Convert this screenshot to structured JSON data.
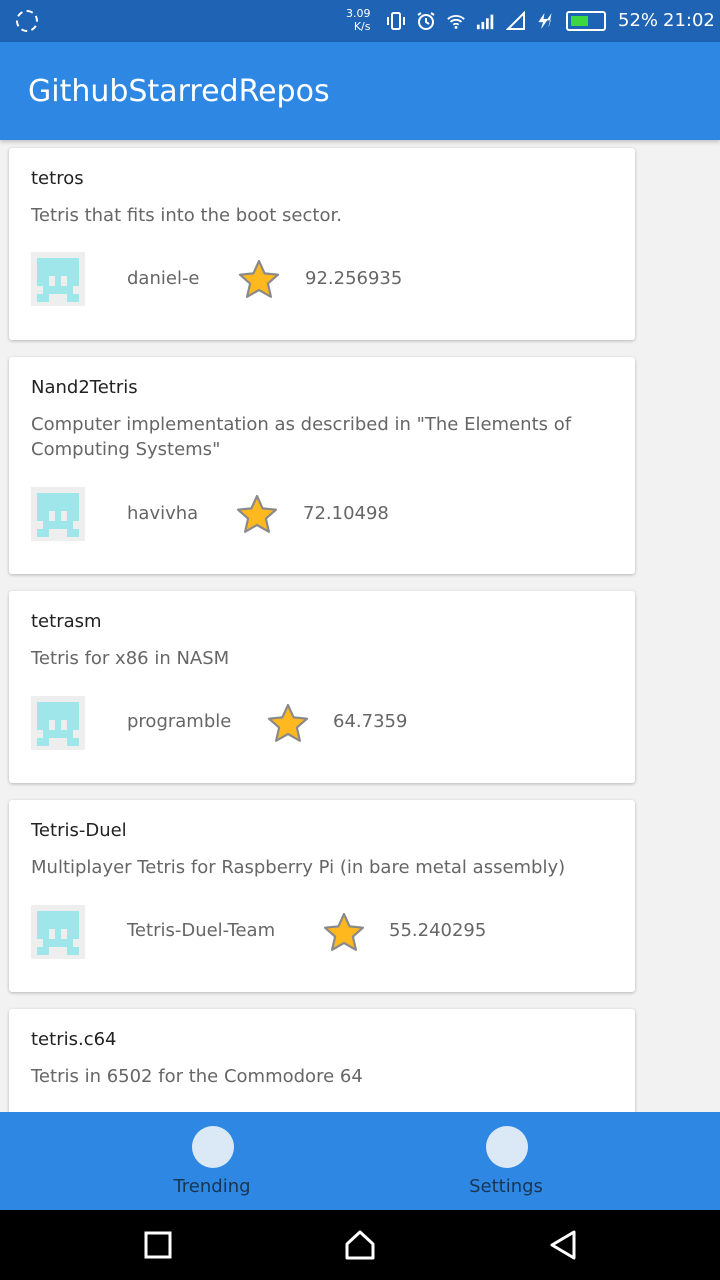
{
  "status_bar": {
    "speed_value": "3.09",
    "speed_unit": "K/s",
    "battery_percent": "52%",
    "battery_level": 0.52,
    "battery_color": "#3fd73f",
    "time": "21:02"
  },
  "app_bar": {
    "title": "GithubStarredRepos"
  },
  "repos": [
    {
      "name": "tetros",
      "description": "Tetris that fits into the boot sector.",
      "owner": "daniel-e",
      "stars": "92.256935"
    },
    {
      "name": "Nand2Tetris",
      "description": "Computer implementation as described in \"The Elements of Computing Systems\"",
      "owner": "havivha",
      "stars": "72.10498"
    },
    {
      "name": "tetrasm",
      "description": "Tetris for x86 in NASM",
      "owner": "programble",
      "stars": "64.7359"
    },
    {
      "name": "Tetris-Duel",
      "description": "Multiplayer Tetris for Raspberry Pi (in bare metal assembly)",
      "owner": "Tetris-Duel-Team",
      "stars": "55.240295"
    },
    {
      "name": "tetris.c64",
      "description": "Tetris in 6502 for the Commodore 64"
    }
  ],
  "bottom_nav": {
    "items": [
      {
        "label": "Trending",
        "icon": "circle-icon"
      },
      {
        "label": "Settings",
        "icon": "circle-icon"
      }
    ]
  },
  "colors": {
    "status_bar": "#1e63b4",
    "app_bar": "#2e88e3",
    "avatar": "#9fe6ea",
    "star_fill": "#ffb81e"
  }
}
